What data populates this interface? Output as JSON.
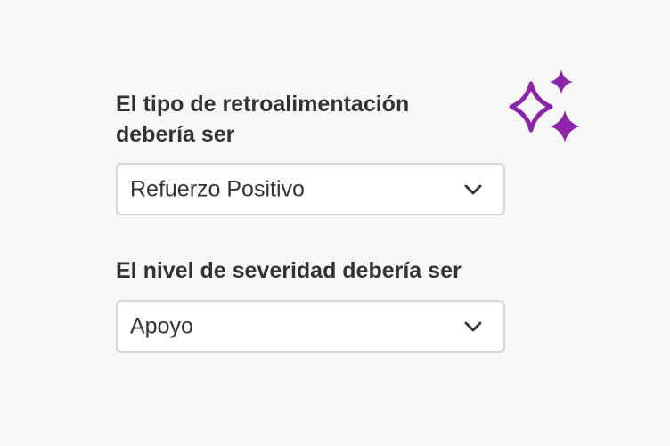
{
  "form": {
    "field1": {
      "label": "El tipo de retroalimentación debería ser",
      "value": "Refuerzo Positivo",
      "icon": "chevron-down-icon"
    },
    "field2": {
      "label": "El nivel de severidad debería ser",
      "value": "Apoyo",
      "icon": "chevron-down-icon"
    }
  },
  "decor": {
    "icon": "sparkles-icon",
    "color": "#8e24aa"
  },
  "colors": {
    "background": "#f7f7f7",
    "text": "#333333",
    "border": "#d6d6d6"
  }
}
